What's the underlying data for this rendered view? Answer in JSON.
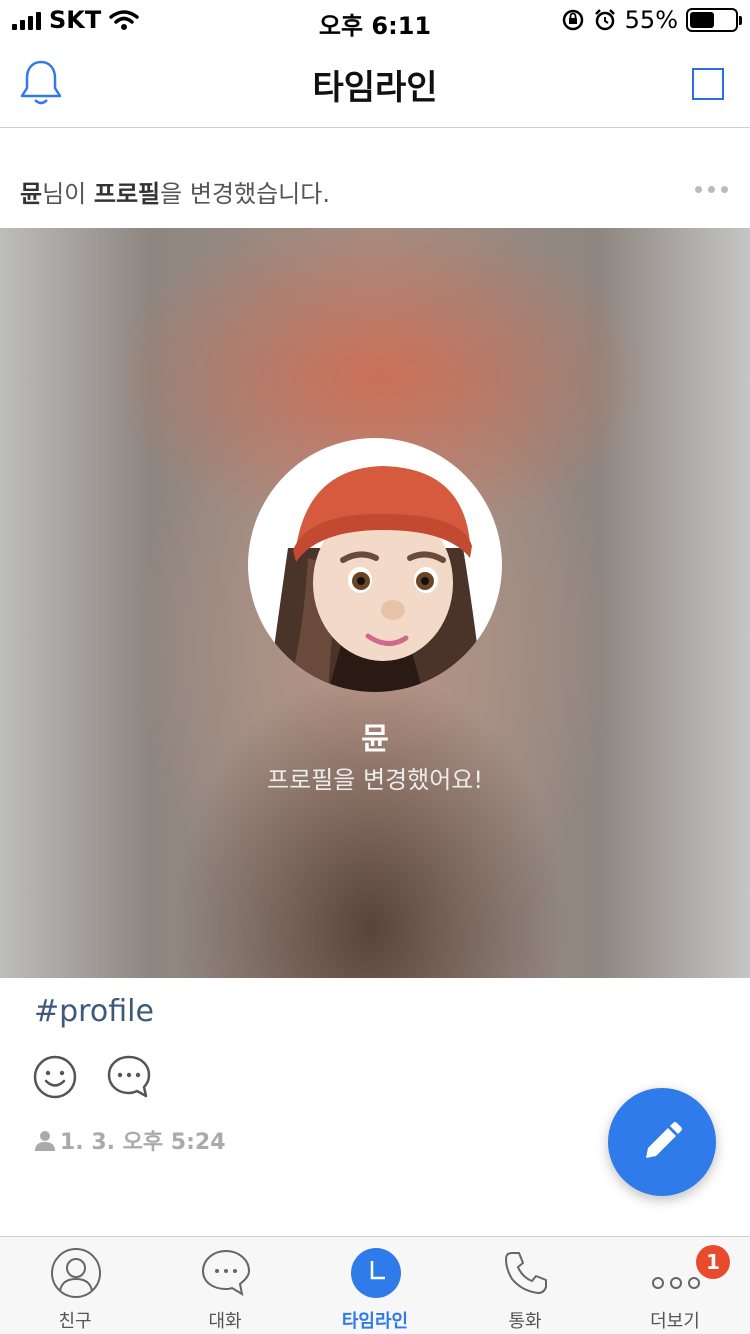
{
  "status_bar": {
    "carrier": "SKT",
    "time": "오후 6:11",
    "battery": "55%",
    "battery_level": 0.55
  },
  "nav": {
    "title": "타임라인",
    "left_icon": "bell-icon",
    "right_icon": "square-icon"
  },
  "post": {
    "header": {
      "name": "뮨",
      "text1": "님이 ",
      "highlight": "프로필",
      "text2": "을 변경했습니다."
    },
    "profile": {
      "name": "뮨",
      "status": "프로필을 변경했어요!"
    },
    "hashtag": "#profile",
    "timestamp": "1. 3. 오후 5:24",
    "actions": [
      "smile-icon",
      "comment-icon"
    ]
  },
  "fab": {
    "icon": "pencil-icon"
  },
  "colors": {
    "accent": "#2f7bea",
    "badge": "#e84a2e",
    "hashtag": "#3d5a7a"
  },
  "tabs": [
    {
      "label": "친구",
      "icon": "friends-icon"
    },
    {
      "label": "대화",
      "icon": "chat-icon"
    },
    {
      "label": "타임라인",
      "icon": "timeline-icon",
      "active": true
    },
    {
      "label": "통화",
      "icon": "phone-icon"
    },
    {
      "label": "더보기",
      "icon": "more-icon",
      "badge": "1"
    }
  ]
}
